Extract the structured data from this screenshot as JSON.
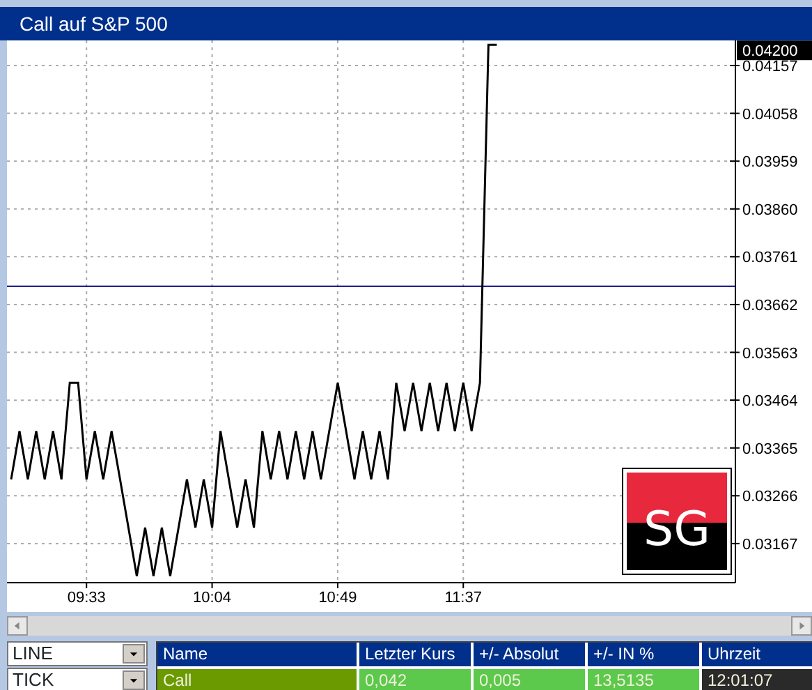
{
  "window": {
    "title": "Call auf S&P 500"
  },
  "chart": {
    "chart_data": {
      "type": "line",
      "categories": [
        null,
        null,
        null,
        null,
        null,
        null,
        null,
        null,
        null,
        "09:33",
        null,
        null,
        null,
        null,
        null,
        null,
        null,
        null,
        null,
        null,
        null,
        null,
        null,
        null,
        "10:04",
        null,
        null,
        null,
        null,
        null,
        null,
        null,
        null,
        null,
        null,
        null,
        null,
        null,
        null,
        "10:49",
        null,
        null,
        null,
        null,
        null,
        null,
        null,
        null,
        null,
        null,
        null,
        null,
        null,
        null,
        "11:37",
        null,
        null,
        null,
        null,
        null,
        null,
        null,
        null,
        null,
        null,
        null,
        null,
        null,
        null,
        null,
        null,
        null,
        null,
        null,
        null,
        null,
        null,
        null,
        null,
        null,
        null,
        null,
        null,
        null,
        null,
        null,
        null
      ],
      "series": [
        {
          "color": "#000000",
          "values": [
            0.033,
            0.034,
            0.033,
            0.034,
            0.033,
            0.034,
            0.033,
            0.035,
            0.035,
            0.033,
            0.034,
            0.033,
            0.034,
            0.033,
            0.032,
            0.031,
            0.032,
            0.031,
            0.032,
            0.031,
            0.032,
            0.033,
            0.032,
            0.033,
            0.032,
            0.034,
            0.033,
            0.032,
            0.033,
            0.032,
            0.034,
            0.033,
            0.034,
            0.033,
            0.034,
            0.033,
            0.034,
            0.033,
            0.034,
            0.035,
            0.034,
            0.033,
            0.034,
            0.033,
            0.034,
            0.033,
            0.035,
            0.034,
            0.035,
            0.034,
            0.035,
            0.034,
            0.035,
            0.034,
            0.035,
            0.034,
            0.035,
            0.042,
            0.042,
            null,
            null,
            null,
            null,
            null,
            null,
            null,
            null,
            null,
            null,
            null,
            null,
            null,
            null,
            null,
            null,
            null,
            null,
            null,
            null,
            null,
            null,
            null,
            null,
            null,
            null,
            null,
            null
          ]
        }
      ],
      "ylim": [
        0.03086,
        0.04209
      ],
      "grid": true,
      "yticks": [
        {
          "value": 0.04157,
          "label": "0.04157"
        },
        {
          "value": 0.04058,
          "label": "0.04058"
        },
        {
          "value": 0.03959,
          "label": "0.03959"
        },
        {
          "value": 0.0386,
          "label": "0.03860"
        },
        {
          "value": 0.03761,
          "label": "0.03761"
        },
        {
          "value": 0.03662,
          "label": "0.03662"
        },
        {
          "value": 0.03563,
          "label": "0.03563"
        },
        {
          "value": 0.03464,
          "label": "0.03464"
        },
        {
          "value": 0.03365,
          "label": "0.03365"
        },
        {
          "value": 0.03266,
          "label": "0.03266"
        },
        {
          "value": 0.03167,
          "label": "0.03167"
        }
      ],
      "ref_lines": [
        {
          "axis": "y",
          "value": 0.037,
          "color": "#000080"
        }
      ],
      "annotations": [
        "0.04200"
      ]
    },
    "logo": {
      "text": "SG"
    }
  },
  "selectors": [
    {
      "value": "LINE"
    },
    {
      "value": "TICK"
    }
  ],
  "quote_table": {
    "columns": [
      "Name",
      "Letzter Kurs",
      "+/- Absolut",
      "+/- IN %",
      "Uhrzeit"
    ],
    "rows": [
      [
        {
          "text": "Call",
          "color": "#6a9a00"
        },
        {
          "text": "0,042",
          "color": "#5cc84c"
        },
        {
          "text": "0,005",
          "color": "#5cc84c"
        },
        {
          "text": "13,5135",
          "color": "#5cc84c"
        },
        {
          "text": "12:01:07",
          "color": "#2a2a2a"
        }
      ]
    ]
  }
}
